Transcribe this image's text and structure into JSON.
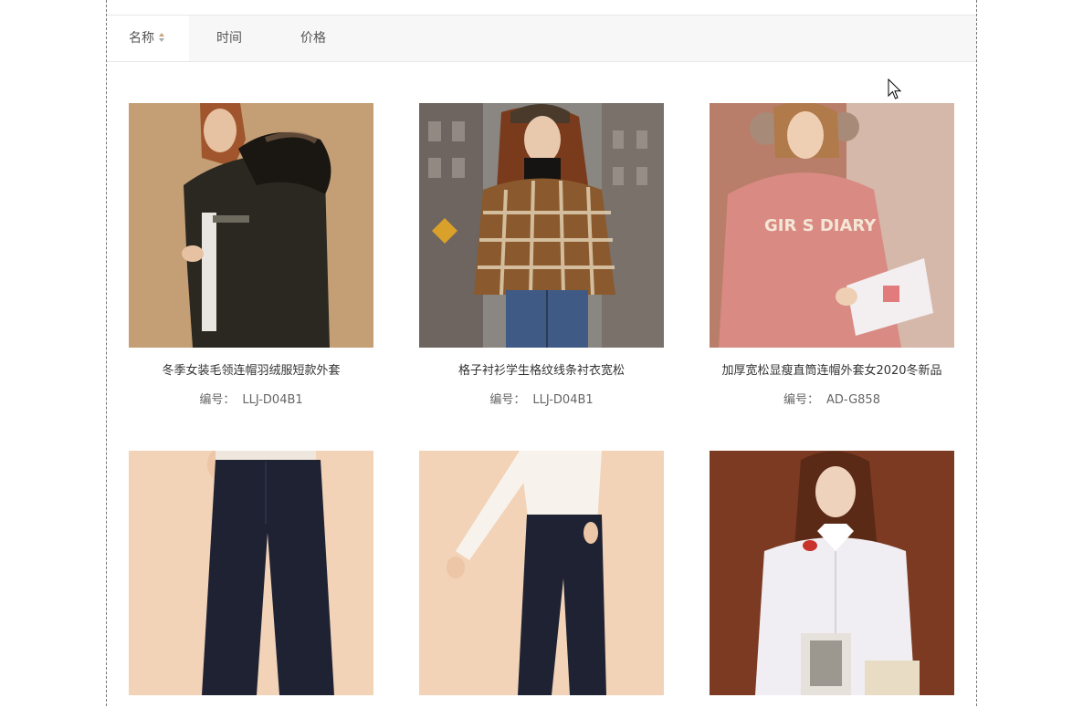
{
  "sort_bar": {
    "tabs": [
      {
        "label": "名称",
        "active": true
      },
      {
        "label": "时间",
        "active": false
      },
      {
        "label": "价格",
        "active": false
      }
    ]
  },
  "products": [
    {
      "title": "冬季女装毛领连帽羽绒服短款外套",
      "code_label": "编号：",
      "code": "LLJ-D04B1"
    },
    {
      "title": "格子衬衫学生格纹线条衬衣宽松",
      "code_label": "编号：",
      "code": "LLJ-D04B1"
    },
    {
      "title": "加厚宽松显瘦直筒连帽外套女2020冬新品",
      "code_label": "编号：",
      "code": "AD-G858"
    },
    {
      "title": "",
      "code_label": "",
      "code": ""
    },
    {
      "title": "",
      "code_label": "",
      "code": ""
    },
    {
      "title": "",
      "code_label": "",
      "code": ""
    }
  ],
  "colors": {
    "accent_arrow": "#c8a27a",
    "tab_bg": "#f7f7f7"
  }
}
